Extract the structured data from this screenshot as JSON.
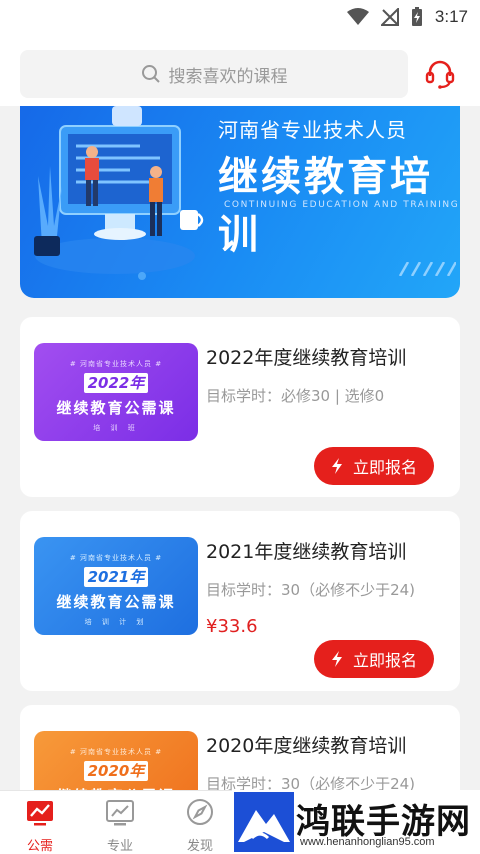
{
  "status_bar": {
    "time": "3:17"
  },
  "search": {
    "placeholder": "搜索喜欢的课程"
  },
  "banner": {
    "subtitle": "河南省专业技术人员",
    "title": "继续教育培训",
    "english": "CONTINUING EDUCATION AND TRAINING"
  },
  "courses": [
    {
      "title": "2022年度继续教育培训",
      "hours": "目标学时：必修30 | 选修0",
      "price": "",
      "thumb": {
        "header": "# 河南省专业技术人员 #",
        "year": "2022年",
        "name": "继续教育公需课",
        "footer": "培 训 班"
      },
      "enroll_label": "立即报名",
      "theme_color": "#8a2be2"
    },
    {
      "title": "2021年度继续教育培训",
      "hours": "目标学时：30（必修不少于24)",
      "price": "¥33.6",
      "thumb": {
        "header": "# 河南省专业技术人员 #",
        "year": "2021年",
        "name": "继续教育公需课",
        "footer": "培 训 计 划"
      },
      "enroll_label": "立即报名",
      "theme_color": "#1e7ae6"
    },
    {
      "title": "2020年度继续教育培训",
      "hours": "目标学时：30（必修不少于24)",
      "price": "",
      "thumb": {
        "header": "# 河南省专业技术人员 #",
        "year": "2020年",
        "name": "继续教育公需课",
        "footer": ""
      },
      "enroll_label": "",
      "theme_color": "#f0781e"
    }
  ],
  "bottom_nav": [
    {
      "label": "公需",
      "icon": "chart-icon",
      "active": true
    },
    {
      "label": "专业",
      "icon": "trend-icon",
      "active": false
    },
    {
      "label": "发现",
      "icon": "compass-icon",
      "active": false
    }
  ],
  "watermark": {
    "text": "鸿联手游网",
    "url": "www.henanhonglian95.com"
  },
  "colors": {
    "accent": "#e5201c",
    "banner": "#1a8cf4"
  }
}
